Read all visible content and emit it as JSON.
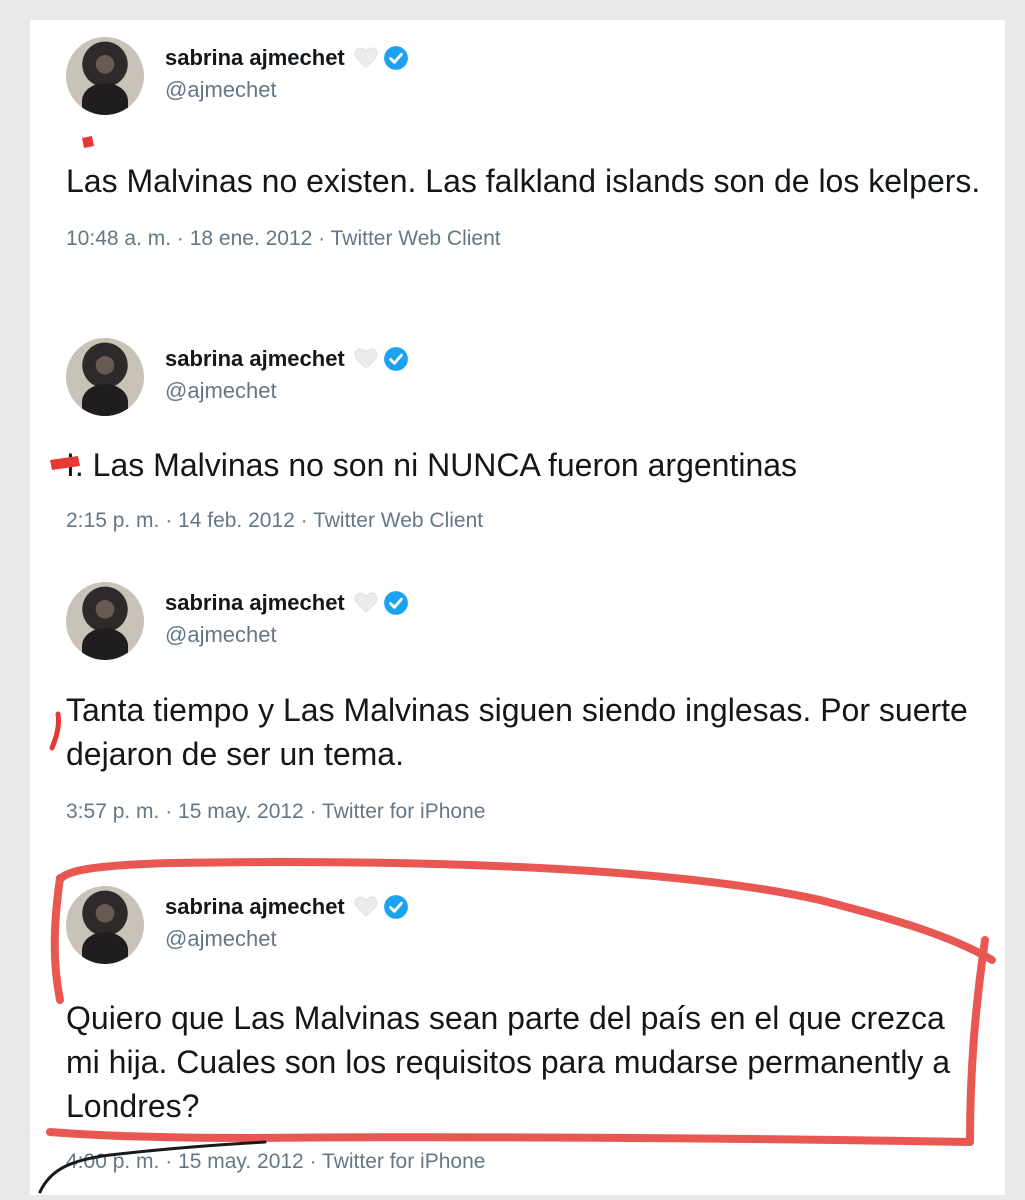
{
  "colors": {
    "verified_blue": "#1da1f2",
    "annotation_red": "#e53935",
    "secondary_text": "#657786"
  },
  "tweets": [
    {
      "name": "sabrina ajmechet",
      "handle": "@ajmechet",
      "text": "Las Malvinas no existen. Las falkland islands son de los kelpers.",
      "meta": "10:48 a. m. · 18 ene. 2012 · Twitter Web Client"
    },
    {
      "name": "sabrina ajmechet",
      "handle": "@ajmechet",
      "text": "I. Las Malvinas no son ni NUNCA fueron argentinas",
      "meta": "2:15 p. m. · 14 feb. 2012 · Twitter Web Client"
    },
    {
      "name": "sabrina ajmechet",
      "handle": "@ajmechet",
      "text": "Tanta tiempo y Las Malvinas siguen siendo inglesas. Por suerte dejaron de ser un tema.",
      "meta": "3:57 p. m. · 15 may. 2012 · Twitter for iPhone"
    },
    {
      "name": "sabrina ajmechet",
      "handle": "@ajmechet",
      "text": "Quiero que Las Malvinas sean parte del país en el que crezca mi hija. Cuales son los requisitos para mudarse permanently a Londres?",
      "meta": "4:00 p. m. · 15 may. 2012 · Twitter for iPhone"
    }
  ],
  "icons": {
    "avatar": "avatar",
    "heart": "heart-icon",
    "verified": "verified-badge-icon"
  }
}
